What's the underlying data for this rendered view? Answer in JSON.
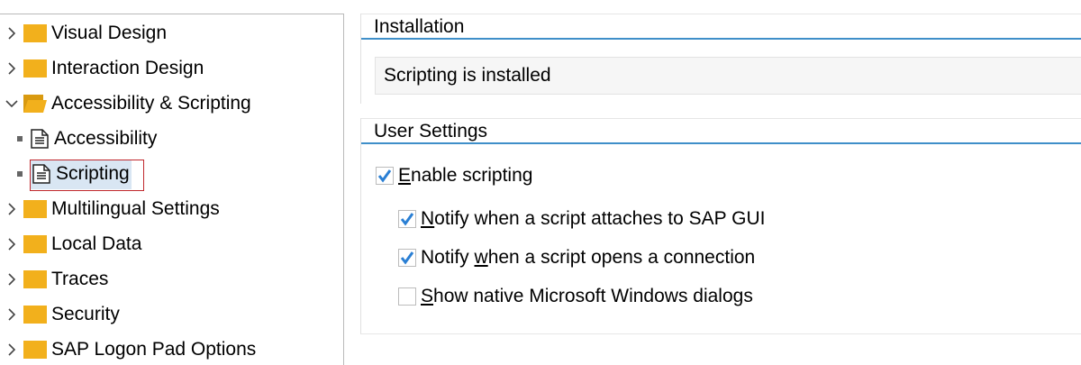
{
  "tree": {
    "items": [
      {
        "label": "Visual Design",
        "type": "folder",
        "expanded": false
      },
      {
        "label": "Interaction Design",
        "type": "folder",
        "expanded": false
      },
      {
        "label": "Accessibility & Scripting",
        "type": "folder",
        "expanded": true
      },
      {
        "label": "Accessibility",
        "type": "page",
        "selected": false
      },
      {
        "label": "Scripting",
        "type": "page",
        "selected": true
      },
      {
        "label": "Multilingual Settings",
        "type": "folder",
        "expanded": false
      },
      {
        "label": "Local Data",
        "type": "folder",
        "expanded": false
      },
      {
        "label": "Traces",
        "type": "folder",
        "expanded": false
      },
      {
        "label": "Security",
        "type": "folder",
        "expanded": false
      },
      {
        "label": "SAP Logon Pad Options",
        "type": "folder",
        "expanded": false
      }
    ]
  },
  "installation": {
    "title": "Installation",
    "status": "Scripting is installed"
  },
  "user_settings": {
    "title": "User Settings",
    "enable": {
      "prefix": "",
      "accel": "E",
      "rest": "nable scripting",
      "checked": true
    },
    "notify_attach": {
      "prefix": "",
      "accel": "N",
      "rest": "otify when a script attaches to SAP GUI",
      "checked": true
    },
    "notify_open": {
      "prefix": "Notify ",
      "accel": "w",
      "rest": "hen a script opens a connection",
      "checked": true
    },
    "native_dialogs": {
      "prefix": "",
      "accel": "S",
      "rest": "how native Microsoft Windows dialogs",
      "checked": false
    }
  },
  "colors": {
    "accent": "#3f8fc9",
    "folder": "#f2b01c",
    "check": "#2a7fd4",
    "selection": "#d9e6f3",
    "focus": "#c0282d"
  }
}
